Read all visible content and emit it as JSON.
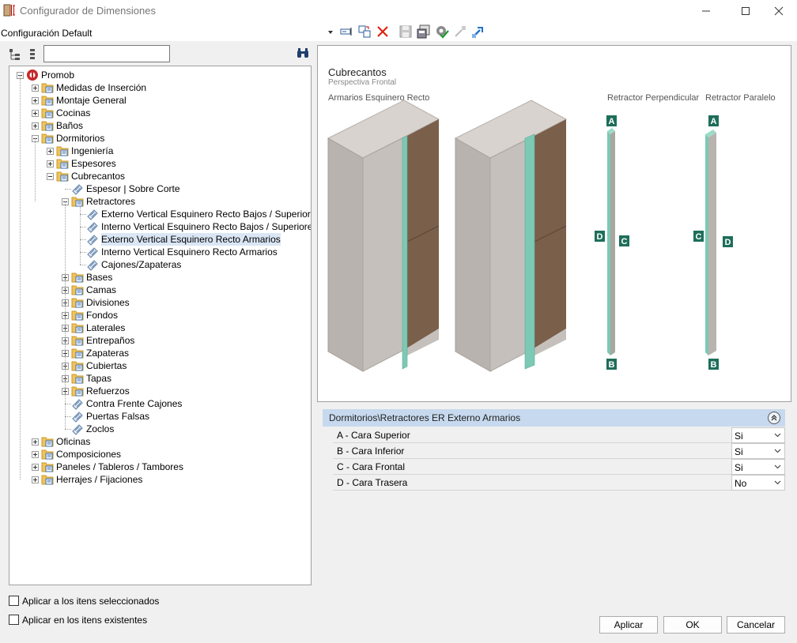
{
  "window": {
    "title": "Configurador de Dimensiones"
  },
  "toolbar": {
    "config_value": "Configuración Default"
  },
  "tree": {
    "nodes": [
      "Promob",
      "Medidas de Inserción",
      "Montaje General",
      "Cocinas",
      "Baños",
      "Dormitorios",
      "Ingeniería",
      "Espesores",
      "Cubrecantos",
      "Espesor | Sobre Corte",
      "Retractores",
      "Externo Vertical Esquinero Recto Bajos / Superiores",
      "Interno Vertical Esquinero Recto Bajos / Superiores",
      "Externo Vertical Esquinero Recto Armarios",
      "Interno Vertical Esquinero Recto Armarios",
      "Cajones/Zapateras",
      "Bases",
      "Camas",
      "Divisiones",
      "Fondos",
      "Laterales",
      "Entrepaños",
      "Zapateras",
      "Cubiertas",
      "Tapas",
      "Refuerzos",
      "Contra Frente Cajones",
      "Puertas Falsas",
      "Zoclos",
      "Oficinas",
      "Composiciones",
      "Paneles / Tableros / Tambores",
      "Herrajes / Fijaciones"
    ]
  },
  "options": {
    "apply_selected": "Aplicar a los itens seleccionados",
    "apply_existing": "Aplicar en los itens existentes"
  },
  "preview": {
    "title": "Cubrecantos",
    "subtitle": "Perspectiva Frontal",
    "section_armarios": "Armarios Esquinero Recto",
    "section_perpendicular": "Retractor Perpendicular",
    "section_paralelo": "Retractor Paralelo",
    "marker_a": "A",
    "marker_b": "B",
    "marker_c": "C",
    "marker_d": "D"
  },
  "properties": {
    "header": "Dormitorios\\Retractores ER Externo Armarios",
    "rows": [
      {
        "name": "A - Cara Superior",
        "value": "Si"
      },
      {
        "name": "B - Cara Inferior",
        "value": "Si"
      },
      {
        "name": "C - Cara Frontal",
        "value": "Si"
      },
      {
        "name": "D - Cara Trasera",
        "value": "No"
      }
    ]
  },
  "buttons": {
    "apply": "Aplicar",
    "ok": "OK",
    "cancel": "Cancelar"
  },
  "colors": {
    "accent": "#0078d7",
    "edge_band": "#7cc9b5",
    "marker": "#1e6e5a",
    "wood": "#7a5f4b",
    "header_bg": "#c7d9ee"
  }
}
